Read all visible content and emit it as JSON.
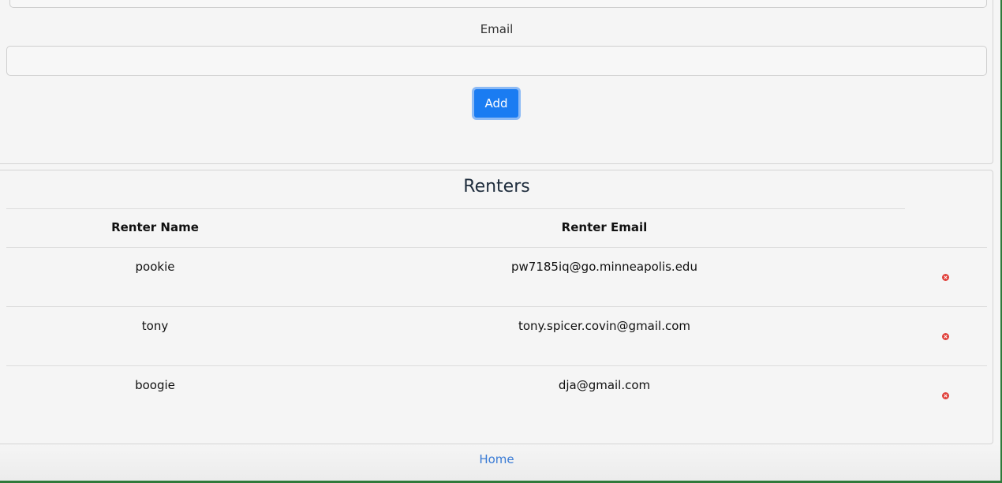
{
  "form": {
    "email_label": "Email",
    "email_value": "",
    "email_placeholder": "",
    "add_label": "Add"
  },
  "renters": {
    "title": "Renters",
    "headers": [
      "Renter Name",
      "Renter Email"
    ],
    "rows": [
      {
        "name": "pookie",
        "email": "pw7185iq@go.minneapolis.edu"
      },
      {
        "name": "tony",
        "email": "tony.spicer.covin@gmail.com"
      },
      {
        "name": "boogie",
        "email": "dja@gmail.com"
      }
    ]
  },
  "footer": {
    "home_label": "Home"
  },
  "colors": {
    "primary": "#1a7cf2",
    "delete": "#e0413b",
    "link": "#3a7bd5"
  }
}
